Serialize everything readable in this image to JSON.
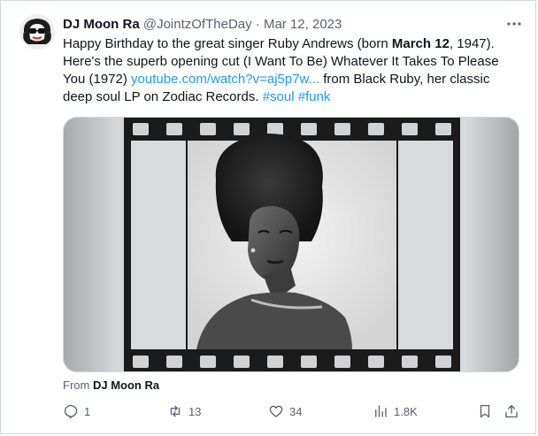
{
  "tweet": {
    "author_name": "DJ Moon Ra",
    "author_handle": "@JointzOfTheDay",
    "separator": "·",
    "date": "Mar 12, 2023",
    "text": {
      "part1": "Happy Birthday to the great singer Ruby Andrews (born ",
      "bold1": "March 12",
      "part2": ", 1947). Here's the superb opening cut (I Want To Be) Whatever It Takes To Please You (1972) ",
      "link": "youtube.com/watch?v=aj5p7w...",
      "part3": " from Black Ruby, her classic deep soul LP on Zodiac Records. ",
      "hashtag1": "#soul",
      "hashtag2": "#funk"
    },
    "media_from_label": "From",
    "media_from_name": "DJ Moon Ra"
  },
  "actions": {
    "reply_count": "1",
    "retweet_count": "13",
    "like_count": "34",
    "views_count": "1.8K"
  },
  "icons": {
    "more": "more-icon",
    "reply": "reply-icon",
    "retweet": "retweet-icon",
    "like": "heart-icon",
    "views": "views-icon",
    "bookmark": "bookmark-icon",
    "share": "share-icon"
  },
  "colors": {
    "link": "#1d9bf0",
    "muted": "#536471",
    "text": "#0f1419"
  }
}
